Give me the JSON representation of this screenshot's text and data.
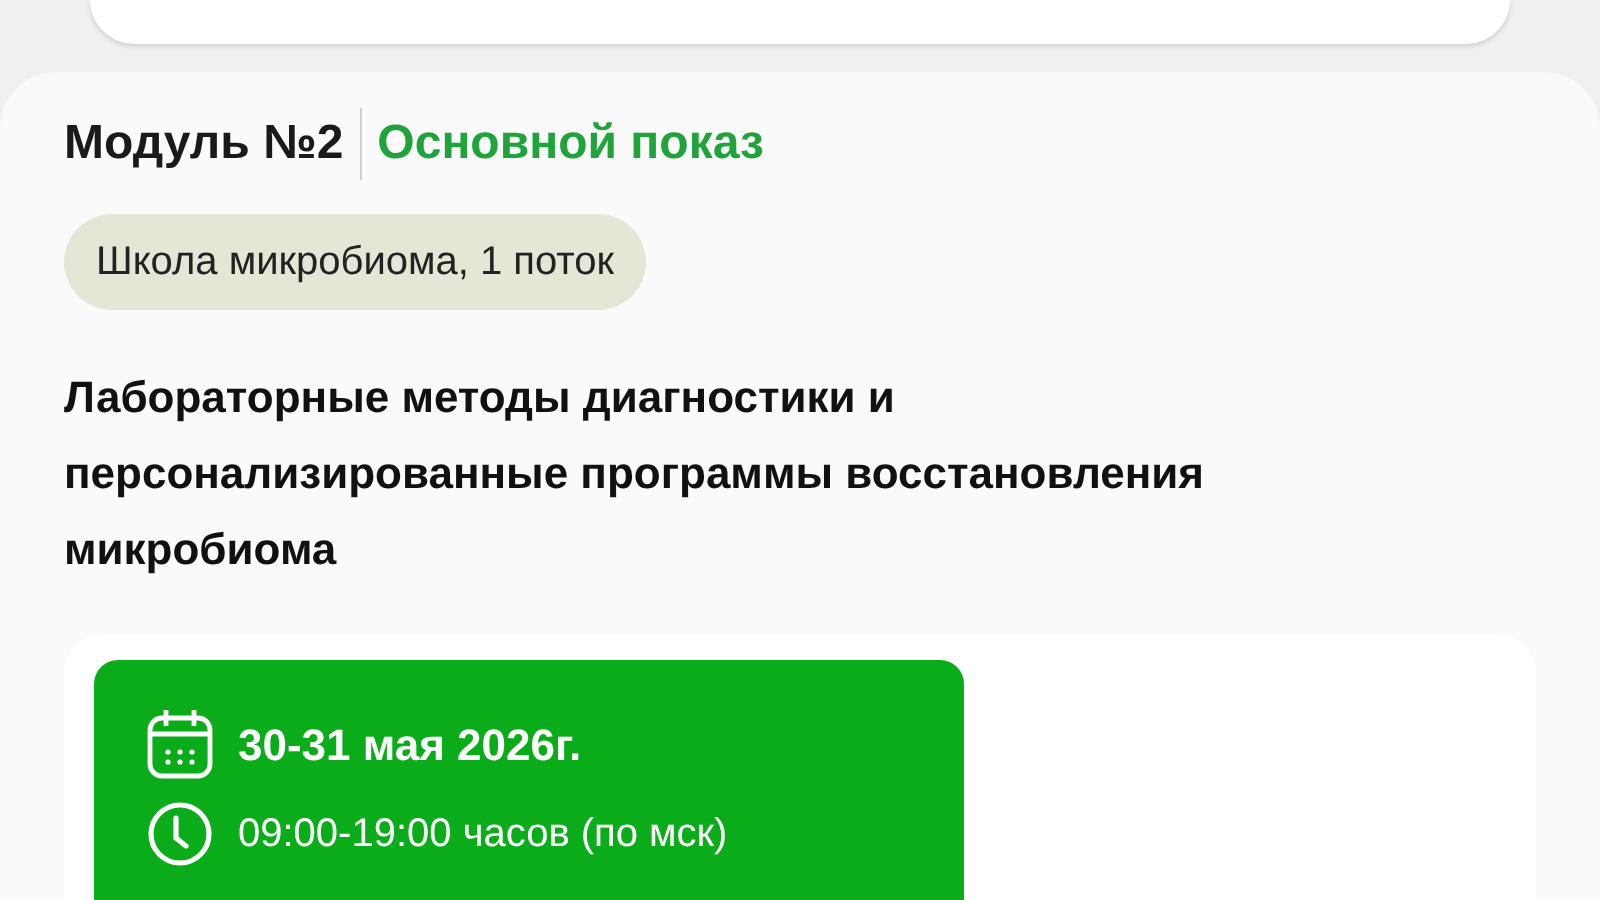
{
  "module": {
    "number": "Модуль №2",
    "type": "Основной показ"
  },
  "tag": "Школа микробиома, 1 поток",
  "title": "Лабораторные методы диагностики и персонализированные программы восстановления микробиома",
  "schedule": {
    "date": "30-31 мая 2026г.",
    "time": "09:00-19:00 часов (по мск)"
  }
}
